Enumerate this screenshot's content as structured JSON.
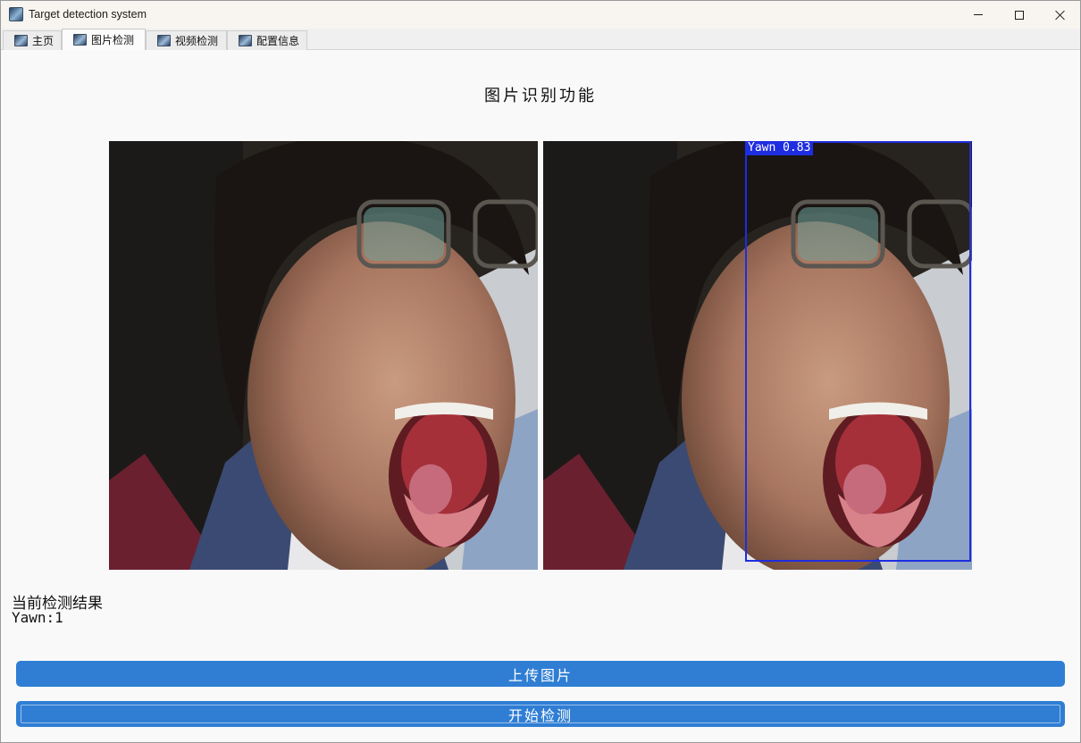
{
  "window": {
    "title": "Target detection system",
    "icons": {
      "app": "app-icon",
      "minimize": "minimize-icon",
      "maximize": "maximize-icon",
      "close": "close-icon"
    }
  },
  "tabs": [
    {
      "label": "主页",
      "icon": "tab-app-icon",
      "active": false
    },
    {
      "label": "图片检测",
      "icon": "tab-app-icon",
      "active": true
    },
    {
      "label": "视频检测",
      "icon": "tab-app-icon",
      "active": false
    },
    {
      "label": "配置信息",
      "icon": "tab-app-icon",
      "active": false
    }
  ],
  "main": {
    "heading": "图片识别功能",
    "detection": {
      "label": "Yawn 0.83",
      "color": "#1e2de0"
    },
    "result_title": "当前检测结果",
    "result_value": "Yawn:1"
  },
  "buttons": {
    "upload": "上传图片",
    "detect": "开始检测",
    "color": "#2f7ed4"
  }
}
